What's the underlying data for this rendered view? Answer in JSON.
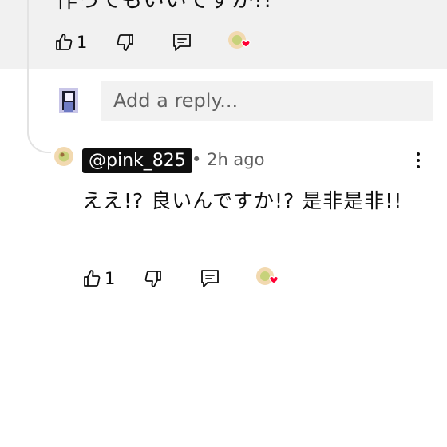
{
  "prev_comment": {
    "text_cut": "作ってもいいですか!!",
    "like_count": "1",
    "icons": [
      "thumbs-up-icon",
      "thumbs-down-icon",
      "reply-icon",
      "creator-heart-icon"
    ]
  },
  "reply_input": {
    "placeholder": "Add a reply..."
  },
  "comment": {
    "handle": "@pink_825",
    "separator": "•",
    "time": "2h ago",
    "text": "ええ!? 良いんですか!? 是非是非!!",
    "like_count": "1",
    "icons": [
      "thumbs-up-icon",
      "thumbs-down-icon",
      "reply-icon",
      "creator-heart-icon",
      "more-vert-icon"
    ]
  },
  "colors": {
    "top_band": "#f1f1f1",
    "heart": "#ff0033",
    "handle_bg": "#0f0f0f",
    "meta_text": "#606060"
  }
}
